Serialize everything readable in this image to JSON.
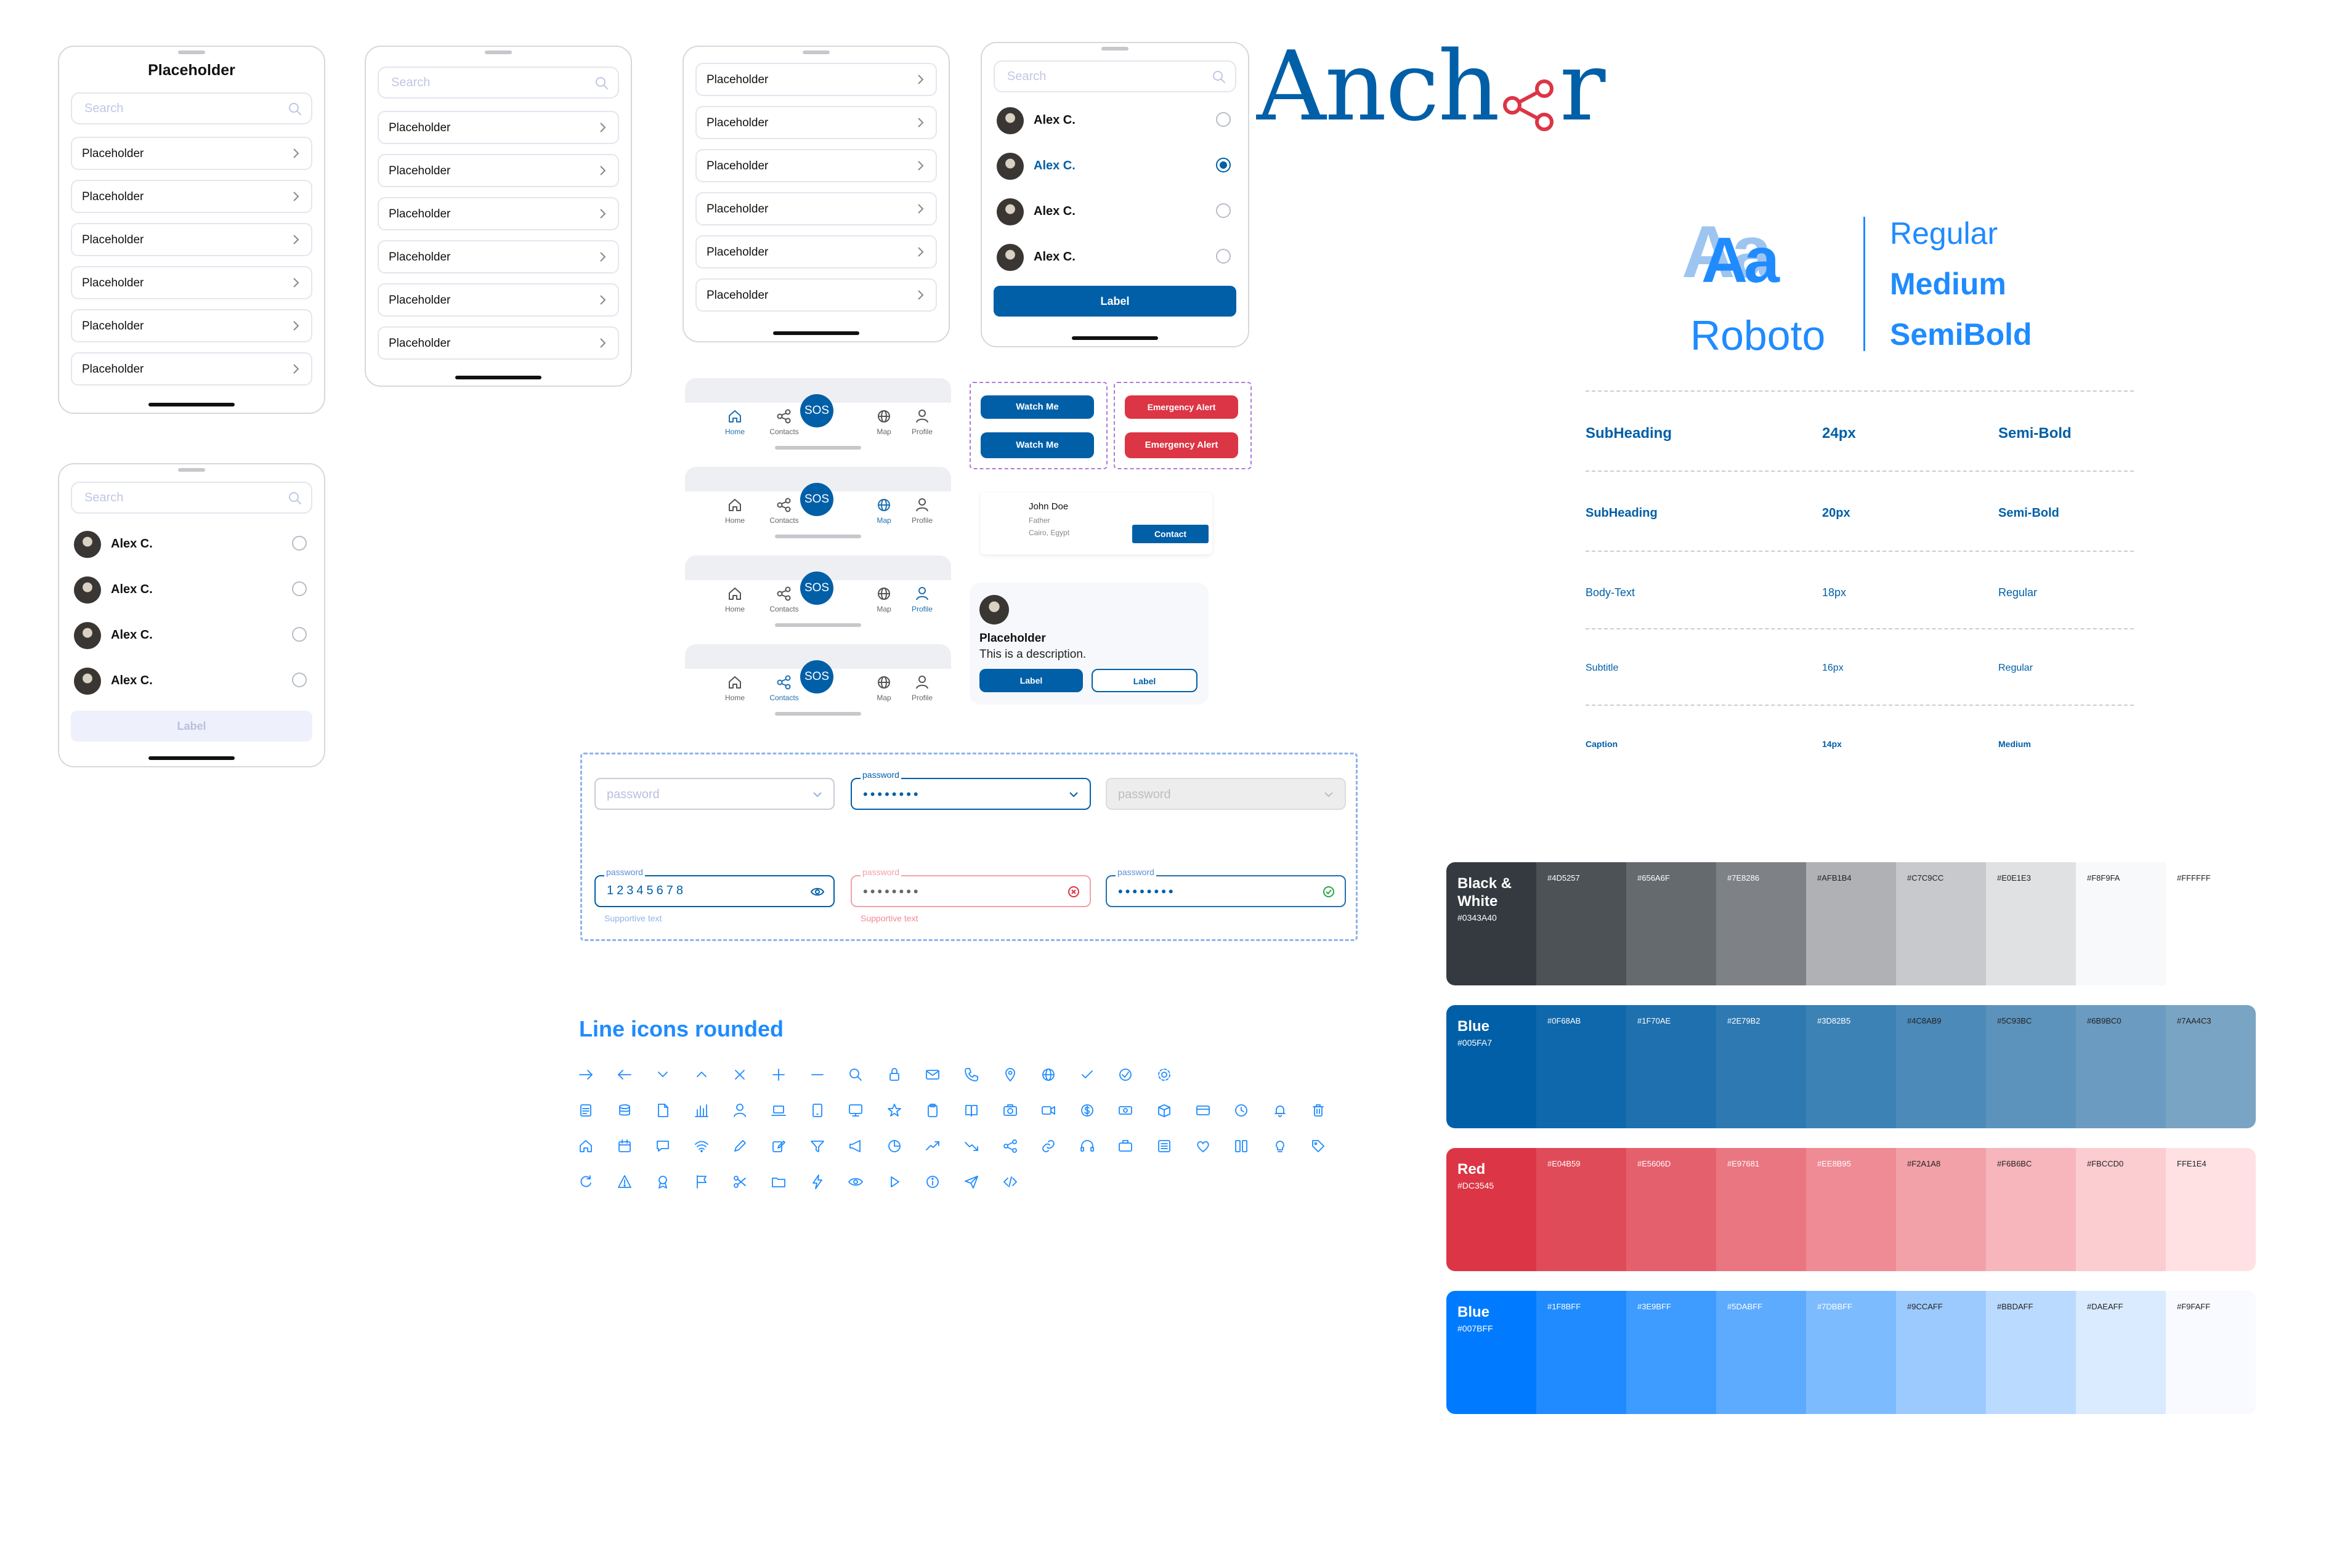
{
  "brand": {
    "name": "Anchor",
    "prefix": "Anch",
    "suffix": "r",
    "color": "#005FA7"
  },
  "frame1": {
    "title": "Placeholder",
    "search_placeholder": "Search",
    "rows": [
      "Placeholder",
      "Placeholder",
      "Placeholder",
      "Placeholder",
      "Placeholder",
      "Placeholder"
    ]
  },
  "frame2": {
    "search_placeholder": "Search",
    "rows": [
      "Placeholder",
      "Placeholder",
      "Placeholder",
      "Placeholder",
      "Placeholder",
      "Placeholder"
    ]
  },
  "frame3": {
    "rows": [
      "Placeholder",
      "Placeholder",
      "Placeholder",
      "Placeholder",
      "Placeholder",
      "Placeholder"
    ]
  },
  "frame4": {
    "search_placeholder": "Search",
    "contacts": [
      {
        "name": "Alex C."
      },
      {
        "name": "Alex C."
      },
      {
        "name": "Alex C."
      },
      {
        "name": "Alex C."
      }
    ],
    "selected_index": 1,
    "button_label": "Label"
  },
  "frame5": {
    "search_placeholder": "Search",
    "contacts": [
      {
        "name": "Alex C."
      },
      {
        "name": "Alex C."
      },
      {
        "name": "Alex C."
      },
      {
        "name": "Alex C."
      }
    ],
    "button_label": "Label"
  },
  "navbars": [
    {
      "active": "Home"
    },
    {
      "active": "Map"
    },
    {
      "active": "Profile"
    },
    {
      "active": "Contacts"
    }
  ],
  "nav": {
    "home": "Home",
    "contacts": "Contacts",
    "sos": "SOS",
    "map": "Map",
    "profile": "Profile"
  },
  "buttons": {
    "watch_me": "Watch Me",
    "emergency_alert": "Emergency Alert"
  },
  "contact_card": {
    "name": "John Doe",
    "relation": "Father",
    "location": "Cairo, Egypt",
    "button": "Contact"
  },
  "info_card": {
    "title": "Placeholder",
    "description": "This is a description.",
    "primary": "Label",
    "secondary": "Label"
  },
  "fields": {
    "placeholder": "password",
    "label": "password",
    "dots": "••••••••",
    "revealed": "12345678",
    "helper": "Supportive text"
  },
  "icons_title": "Line icons rounded",
  "icons": [
    [
      "arrow-right",
      "arrow-left",
      "chevron-down",
      "chevron-up",
      "close",
      "plus",
      "minus",
      "search",
      "lock",
      "mail",
      "phone",
      "location-pin",
      "globe",
      "check",
      "check-circle",
      "settings"
    ],
    [
      "document",
      "database",
      "file",
      "bar-chart",
      "user",
      "laptop",
      "tablet",
      "monitor",
      "star",
      "clipboard",
      "book",
      "camera",
      "video",
      "dollar-circle",
      "cash",
      "box",
      "credit-card",
      "clock",
      "bell",
      "trash"
    ],
    [
      "home",
      "calendar",
      "chat",
      "wifi",
      "pen",
      "edit",
      "filter",
      "megaphone",
      "pie-chart",
      "trending-up",
      "trending-down",
      "share",
      "link",
      "headset",
      "briefcase",
      "list",
      "heart",
      "columns",
      "bulb",
      "tag"
    ],
    [
      "refresh",
      "warning",
      "award",
      "flag",
      "scissors",
      "folder",
      "flash",
      "eye",
      "play",
      "info",
      "send",
      "code"
    ]
  ],
  "typography": {
    "sample": "Aa",
    "family": "Roboto",
    "weights": [
      "Regular",
      "Medium",
      "SemiBold"
    ],
    "rows": [
      {
        "name": "SubHeading",
        "size": "24px",
        "weight": "Semi-Bold"
      },
      {
        "name": "SubHeading",
        "size": "20px",
        "weight": "Semi-Bold"
      },
      {
        "name": "Body-Text",
        "size": "18px",
        "weight": "Regular"
      },
      {
        "name": "Subtitle",
        "size": "16px",
        "weight": "Regular"
      },
      {
        "name": "Caption",
        "size": "14px",
        "weight": "Medium"
      }
    ]
  },
  "palettes": [
    {
      "name": "Black & White",
      "hex": "#0343A40",
      "base": "#343A40",
      "swatches": [
        [
          "#4D5257",
          "#4D5257"
        ],
        [
          "#656A6F",
          "#656A6F"
        ],
        [
          "#7E8286",
          "#7E8286"
        ],
        [
          "#AFB1B4",
          "#AFB1B4"
        ],
        [
          "#C7C9CC",
          "#C7C9CC"
        ],
        [
          "#E0E1E3",
          "#E0E1E3"
        ],
        [
          "#F8F9FA",
          "#F8F9FA"
        ],
        [
          "#FFFFFF",
          "#FFFFFF"
        ]
      ]
    },
    {
      "name": "Blue",
      "hex": "#005FA7",
      "base": "#005FA7",
      "swatches": [
        [
          "#0F68AB",
          "#0F68AB"
        ],
        [
          "#1F70AE",
          "#1F70AE"
        ],
        [
          "#2E79B2",
          "#2E79B2"
        ],
        [
          "#3D82B5",
          "#3D82B5"
        ],
        [
          "#4C8AB9",
          "#4C8AB9"
        ],
        [
          "#5C93BC",
          "#5C93BC"
        ],
        [
          "#6B9BC0",
          "#6B9BC0"
        ],
        [
          "#7AA4C3",
          "#7AA4C3"
        ]
      ]
    },
    {
      "name": "Red",
      "hex": "#DC3545",
      "base": "#DC3545",
      "swatches": [
        [
          "#E04B59",
          "#E04B59"
        ],
        [
          "#E5606D",
          "#E5606D"
        ],
        [
          "#E97681",
          "#E97681"
        ],
        [
          "#EE8B95",
          "#EE8B95"
        ],
        [
          "#F2A1A8",
          "#F2A1A8"
        ],
        [
          "#F6B6BC",
          "#F6B6BC"
        ],
        [
          "#FBCCD0",
          "#FBCCD0"
        ],
        [
          "FFE1E4",
          "#FFE1E4"
        ]
      ]
    },
    {
      "name": "Blue",
      "hex": "#007BFF",
      "base": "#007BFF",
      "swatches": [
        [
          "#1F8BFF",
          "#1F8BFF"
        ],
        [
          "#3E9BFF",
          "#3E9BFF"
        ],
        [
          "#5DABFF",
          "#5DABFF"
        ],
        [
          "#7DBBFF",
          "#7DBBFF"
        ],
        [
          "#9CCAFF",
          "#9CCAFF"
        ],
        [
          "#BBDAFF",
          "#BBDAFF"
        ],
        [
          "#DAEAFF",
          "#DAEAFF"
        ],
        [
          "#F9FAFF",
          "#F9FAFF"
        ]
      ]
    }
  ]
}
